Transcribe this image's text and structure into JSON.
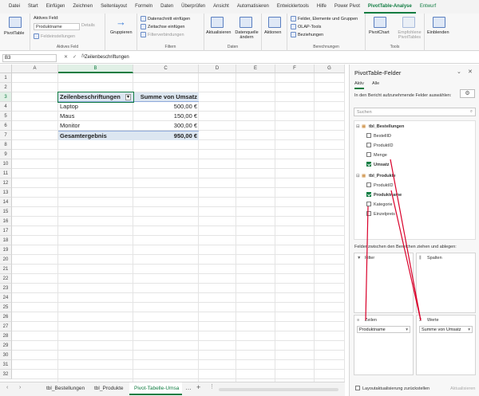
{
  "menu": [
    "Datei",
    "Start",
    "Einfügen",
    "Zeichnen",
    "Seitenlayout",
    "Formeln",
    "Daten",
    "Überprüfen",
    "Ansicht",
    "Automatisieren",
    "Entwicklertools",
    "Hilfe",
    "Power Pivot",
    "PivotTable-Analyse",
    "Entwurf"
  ],
  "ribbon": {
    "pivottable": "PivotTable",
    "active_field_label": "Aktives Feld:",
    "active_field_value": "Produktname",
    "details": "Details",
    "field_settings": "Feldeinstellungen",
    "group_active_field": "Aktives Feld",
    "grouping": "Gruppieren",
    "slicer": "Datenschnitt einfügen",
    "timeline": "Zeitachse einfügen",
    "filter_connections": "Filterverbindungen",
    "group_filter": "Filtern",
    "refresh": "Aktualisieren",
    "change_source": "Datenquelle ändern",
    "group_data": "Daten",
    "actions": "Aktionen",
    "fields_items_sets": "Felder, Elemente und Gruppen",
    "olap_tools": "OLAP-Tools",
    "relationships": "Beziehungen",
    "group_calculations": "Berechnungen",
    "pivotchart": "PivotChart",
    "recommended": "Empfohlene PivotTables",
    "group_tools": "Tools",
    "show": "Einblenden"
  },
  "formula_bar": {
    "name_box": "B3",
    "formula": "Zeilenbeschriftungen"
  },
  "columns": [
    "A",
    "B",
    "C",
    "D",
    "E",
    "F",
    "G"
  ],
  "rows": [
    "1",
    "2",
    "3",
    "4",
    "5",
    "6",
    "7",
    "8",
    "9",
    "10",
    "11",
    "12",
    "13",
    "14",
    "15",
    "16",
    "17",
    "18",
    "19",
    "20",
    "21",
    "22",
    "23",
    "24",
    "25",
    "26",
    "27",
    "28",
    "29",
    "30",
    "31",
    "32"
  ],
  "pivot": {
    "header_rows": "Zeilenbeschriftungen",
    "header_values": "Summe von Umsatz",
    "items": [
      {
        "label": "Laptop",
        "value": "500,00 €"
      },
      {
        "label": "Maus",
        "value": "150,00 €"
      },
      {
        "label": "Monitor",
        "value": "300,00 €"
      }
    ],
    "total_label": "Gesamtergebnis",
    "total_value": "950,00 €"
  },
  "sheets": [
    "tbl_Bestellungen",
    "tbl_Produkte",
    "Pivot-Tabelle-Umsa"
  ],
  "pane": {
    "title": "PivotTable-Felder",
    "tab_active": "Aktiv",
    "tab_all": "Alle",
    "instruction": "In den Bericht aufzunehmende Felder auswählen:",
    "search_placeholder": "Suchen",
    "tables": [
      {
        "name": "tbl_Bestellungen",
        "fields": [
          {
            "name": "BestellID",
            "checked": false
          },
          {
            "name": "ProduktID",
            "checked": false
          },
          {
            "name": "Menge",
            "checked": false
          },
          {
            "name": "Umsatz",
            "checked": true
          }
        ]
      },
      {
        "name": "tbl_Produkte",
        "fields": [
          {
            "name": "ProduktID",
            "checked": false
          },
          {
            "name": "Produktname",
            "checked": true
          },
          {
            "name": "Kategorie",
            "checked": false
          },
          {
            "name": "Einzelpreis",
            "checked": false
          }
        ]
      }
    ],
    "drag_hint": "Felder zwischen den Bereichen ziehen und ablegen:",
    "area_filter": "Filter",
    "area_columns": "Spalten",
    "area_rows": "Zeilen",
    "area_values": "Werte",
    "rows_item": "Produktname",
    "values_item": "Summe von Umsatz",
    "defer_update": "Layoutaktualisierung zurückstellen",
    "update_button": "Aktualisieren"
  },
  "colors": {
    "accent": "#107c41",
    "pivot_header": "#dce6f1",
    "annotation": "#d9002a"
  }
}
